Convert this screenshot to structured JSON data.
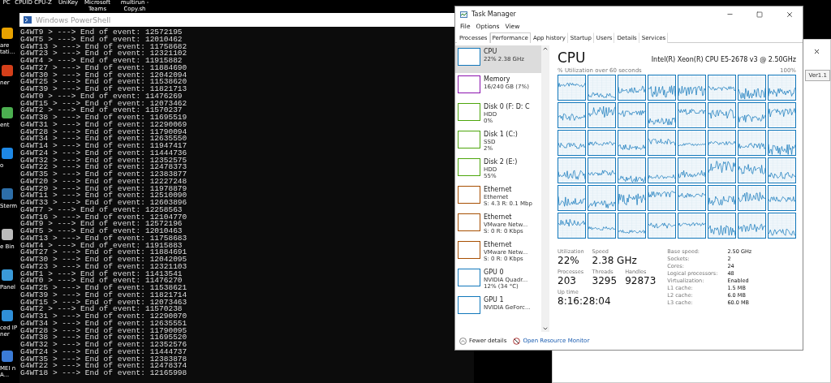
{
  "desktop": {
    "top_labels": [
      "PC",
      "CPUID CPU-Z",
      "UniKey",
      "Microsoft Teams",
      "multirun - Copy.sh"
    ],
    "side_labels": [
      "are tati...",
      "ner",
      "ent",
      "o",
      "Sterm",
      "e Bin",
      "Panel",
      "ced IP ner",
      "MEI n A..."
    ]
  },
  "powershell": {
    "title": "Windows PowerShell",
    "lines": [
      "G4WT9 > ---> End of event: 12572195",
      "G4WT5 > ---> End of event: 12010462",
      "G4WT13 > ---> End of event: 11758682",
      "G4WT23 > ---> End of event: 12321102",
      "G4WT4 > ---> End of event: 11915882",
      "G4WT27 > ---> End of event: 11884690",
      "G4WT30 > ---> End of event: 12042094",
      "G4WT25 > ---> End of event: 11538620",
      "G4WT39 > ---> End of event: 11821713",
      "G4WT0 > ---> End of event: 11476269",
      "G4WT15 > ---> End of event: 12073462",
      "G4WT2 > ---> End of event: 11570237",
      "G4WT38 > ---> End of event: 11695519",
      "G4WT31 > ---> End of event: 12290069",
      "G4WT28 > ---> End of event: 11790094",
      "G4WT34 > ---> End of event: 12635550",
      "G4WT14 > ---> End of event: 11947417",
      "G4WT24 > ---> End of event: 11444736",
      "G4WT32 > ---> End of event: 12352575",
      "G4WT22 > ---> End of event: 12478373",
      "G4WT35 > ---> End of event: 12383877",
      "G4WT20 > ---> End of event: 12227248",
      "G4WT29 > ---> End of event: 11978879",
      "G4WT11 > ---> End of event: 12510090",
      "G4WT33 > ---> End of event: 12603896",
      "G4WT7 > ---> End of event: 12258563",
      "G4WT16 > ---> End of event: 12104770",
      "G4WT9 > ---> End of event: 12572196",
      "G4WT5 > ---> End of event: 12010463",
      "G4WT13 > ---> End of event: 11758683",
      "G4WT4 > ---> End of event: 11915883",
      "G4WT27 > ---> End of event: 11884691",
      "G4WT30 > ---> End of event: 12042095",
      "G4WT23 > ---> End of event: 12321103",
      "G4WT1 > ---> End of event: 11413541",
      "G4WT0 > ---> End of event: 11476270",
      "G4WT25 > ---> End of event: 11538621",
      "G4WT39 > ---> End of event: 11821714",
      "G4WT15 > ---> End of event: 12073463",
      "G4WT2 > ---> End of event: 11570238",
      "G4WT31 > ---> End of event: 12290070",
      "G4WT34 > ---> End of event: 12635551",
      "G4WT28 > ---> End of event: 11790095",
      "G4WT38 > ---> End of event: 11695520",
      "G4WT32 > ---> End of event: 12352576",
      "G4WT24 > ---> End of event: 11444737",
      "G4WT35 > ---> End of event: 12383878",
      "G4WT22 > ---> End of event: 12478374",
      "G4WT18 > ---> End of event: 12165998"
    ]
  },
  "back_window": {
    "button": "Ver1.1"
  },
  "task_manager": {
    "title": "Task Manager",
    "menu": [
      "File",
      "Options",
      "View"
    ],
    "tabs": [
      {
        "label": "Processes",
        "selected": false
      },
      {
        "label": "Performance",
        "selected": true
      },
      {
        "label": "App history",
        "selected": false
      },
      {
        "label": "Startup",
        "selected": false
      },
      {
        "label": "Users",
        "selected": false
      },
      {
        "label": "Details",
        "selected": false
      },
      {
        "label": "Services",
        "selected": false
      }
    ],
    "sidebar": [
      {
        "title": "CPU",
        "lines": [
          "22% 2.38 GHz"
        ],
        "color": "#1177bb",
        "selected": true
      },
      {
        "title": "Memory",
        "lines": [
          "16/240 GB (7%)"
        ],
        "color": "#8b12ae",
        "selected": false
      },
      {
        "title": "Disk 0 (F: D: C",
        "lines": [
          "HDD",
          "0%"
        ],
        "color": "#4da60c",
        "selected": false
      },
      {
        "title": "Disk 1 (C:)",
        "lines": [
          "SSD",
          "2%"
        ],
        "color": "#4da60c",
        "selected": false
      },
      {
        "title": "Disk 2 (E:)",
        "lines": [
          "HDD",
          "55%"
        ],
        "color": "#4da60c",
        "selected": false
      },
      {
        "title": "Ethernet",
        "lines": [
          "Ethernet",
          "S: 4.3 R: 0.1 Mbp"
        ],
        "color": "#a74f01",
        "selected": false
      },
      {
        "title": "Ethernet",
        "lines": [
          "VMware Netw...",
          "S: 0 R: 0 Kbps"
        ],
        "color": "#a74f01",
        "selected": false
      },
      {
        "title": "Ethernet",
        "lines": [
          "VMware Netw...",
          "S: 0 R: 0 Kbps"
        ],
        "color": "#a74f01",
        "selected": false
      },
      {
        "title": "GPU 0",
        "lines": [
          "NVIDIA Quadr...",
          "12% (34 °C)"
        ],
        "color": "#1177bb",
        "selected": false
      },
      {
        "title": "GPU 1",
        "lines": [
          "NVIDIA GeForc..."
        ],
        "color": "#1177bb",
        "selected": false
      }
    ],
    "panel": {
      "title": "CPU",
      "processor": "Intel(R) Xeon(R) CPU E5-2678 v3 @ 2.50GHz",
      "graph_caption": "% Utilization over 60 seconds",
      "graph_max": "100%",
      "stats": [
        {
          "label": "Utilization",
          "value": "22%"
        },
        {
          "label": "Speed",
          "value": "2.38 GHz"
        },
        {
          "label": "Processes",
          "value": "203"
        },
        {
          "label": "Threads",
          "value": "3295"
        },
        {
          "label": "Handles",
          "value": "92873"
        },
        {
          "label": "Up time",
          "value": "8:16:28:04"
        }
      ],
      "specs": [
        {
          "label": "Base speed:",
          "value": "2.50 GHz"
        },
        {
          "label": "Sockets:",
          "value": "2"
        },
        {
          "label": "Cores:",
          "value": "24"
        },
        {
          "label": "Logical processors:",
          "value": "48"
        },
        {
          "label": "Virtualization:",
          "value": "Enabled"
        },
        {
          "label": "L1 cache:",
          "value": "1.5 MB"
        },
        {
          "label": "L2 cache:",
          "value": "6.0 MB"
        },
        {
          "label": "L3 cache:",
          "value": "60.0 MB"
        }
      ]
    },
    "footer": {
      "fewer": "Fewer details",
      "monitor": "Open Resource Monitor"
    }
  }
}
